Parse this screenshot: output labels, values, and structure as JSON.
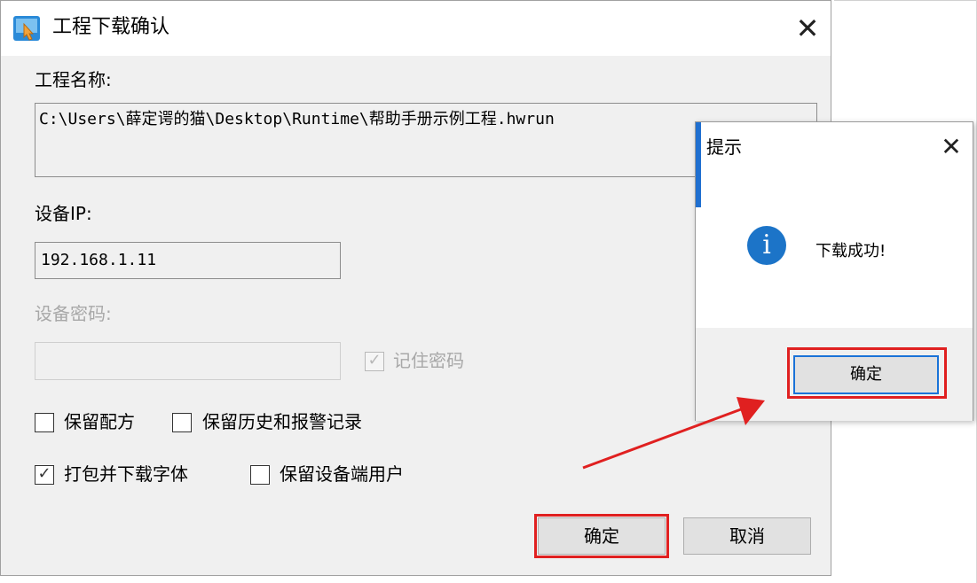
{
  "main_dialog": {
    "title": "工程下载确认",
    "project_name_label": "工程名称:",
    "project_path": "C:\\Users\\薛定谔的猫\\Desktop\\Runtime\\帮助手册示例工程.hwrun",
    "device_ip_label": "设备IP:",
    "device_ip": "192.168.1.11",
    "device_password_label": "设备密码:",
    "remember_password_label": "记住密码",
    "checkboxes": {
      "keep_recipe": "保留配方",
      "keep_history_alarm": "保留历史和报警记录",
      "pack_fonts": "打包并下载字体",
      "keep_device_users": "保留设备端用户"
    },
    "ok_label": "确定",
    "cancel_label": "取消",
    "close_symbol": "✕"
  },
  "popup": {
    "title": "提示",
    "message": "下载成功!",
    "ok_label": "确定",
    "info_symbol": "i",
    "close_symbol": "✕"
  },
  "icons": {
    "app_icon": "app-icon",
    "info_icon": "info-icon",
    "check_mark": "✓"
  },
  "colors": {
    "highlight_red": "#e02020",
    "info_blue": "#1c74c8",
    "focus_blue": "#1a73d8"
  }
}
